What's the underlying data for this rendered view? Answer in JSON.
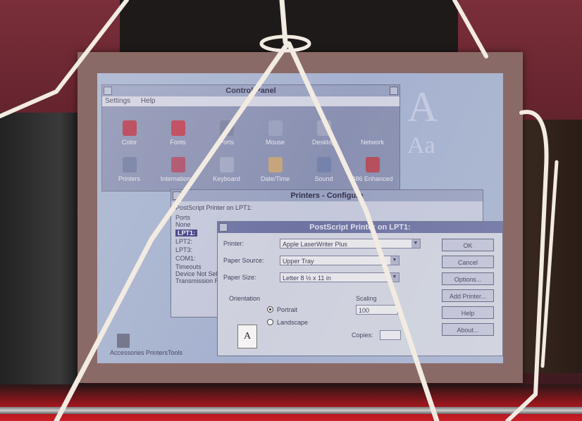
{
  "control_panel": {
    "title": "Control Panel",
    "menu": [
      "Settings",
      "Help"
    ],
    "items": [
      {
        "label": "Color",
        "color": "#b8344a"
      },
      {
        "label": "Fonts",
        "color": "#c23a52"
      },
      {
        "label": "Ports",
        "color": "#7a84a4"
      },
      {
        "label": "Mouse",
        "color": "#9aa4c4"
      },
      {
        "label": "Desktop",
        "color": "#a2aac6"
      },
      {
        "label": "Network",
        "color": "#8c96b6"
      },
      {
        "label": "Printers",
        "color": "#6f7ca6"
      },
      {
        "label": "International",
        "color": "#b04a6a"
      },
      {
        "label": "Keyboard",
        "color": "#a4acc8"
      },
      {
        "label": "Date/Time",
        "color": "#caa87a"
      },
      {
        "label": "Sound",
        "color": "#7486b2"
      },
      {
        "label": "386 Enhanced",
        "color": "#b84a5a"
      }
    ]
  },
  "side_text": {
    "line1": "A",
    "line2": "Aa"
  },
  "printers": {
    "title": "Printers - Configure",
    "subtitle": "PostScript Printer on LPT1:",
    "ports_label": "Ports",
    "ports": [
      "None",
      "LPT1:",
      "LPT2:",
      "LPT3:",
      "COM1:"
    ],
    "selected_port": "LPT1:",
    "timeouts_label": "Timeouts",
    "device_label": "Device Not Selected:",
    "transmission_label": "Transmission Retry:"
  },
  "postscript": {
    "title": "PostScript Printer on LPT1:",
    "printer_label": "Printer:",
    "printer_value": "Apple LaserWriter Plus",
    "paper_source_label": "Paper Source:",
    "paper_source_value": "Upper Tray",
    "paper_size_label": "Paper Size:",
    "paper_size_value": "Letter 8 ½ x 11 in",
    "orientation_label": "Orientation",
    "portrait_label": "Portrait",
    "landscape_label": "Landscape",
    "orientation_icon": "A",
    "scaling_label": "Scaling",
    "scaling_value": "100",
    "copies_label": "Copies:",
    "buttons": [
      "OK",
      "Cancel",
      "Options...",
      "Add Printer...",
      "Help",
      "About..."
    ]
  },
  "desktop_icon": {
    "label": "Accessories  PrintersTools"
  }
}
